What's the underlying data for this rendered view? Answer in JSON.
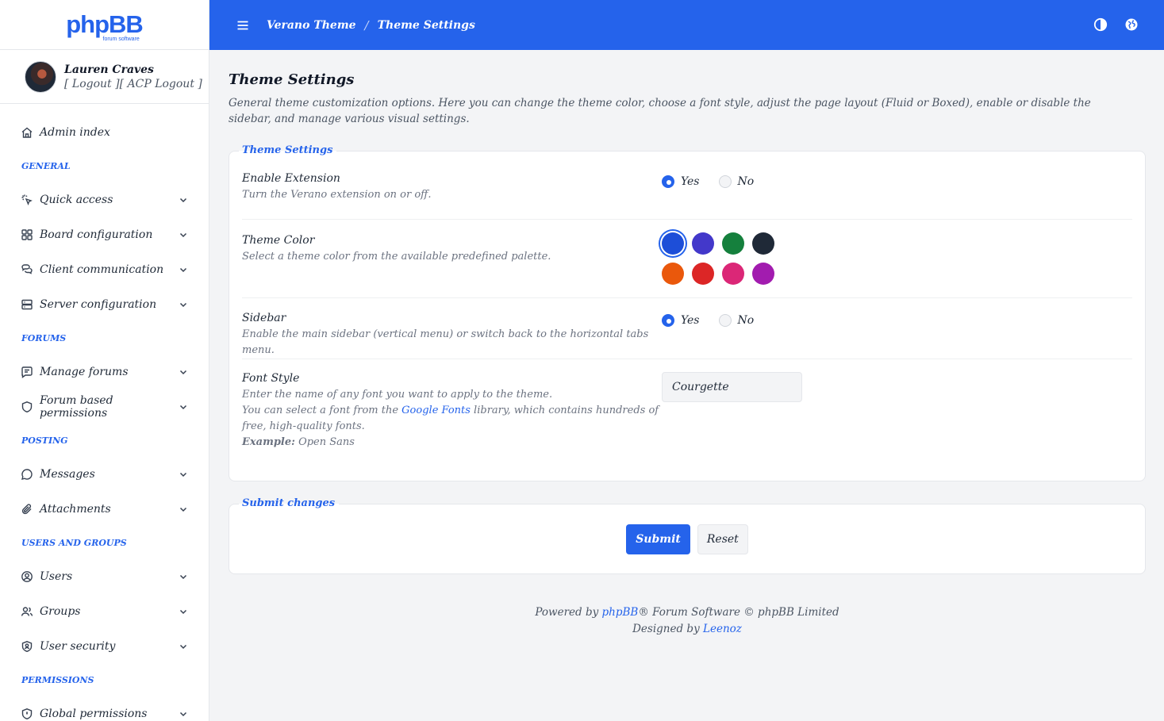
{
  "brand": {
    "logo": "phpBB",
    "logo_sub": "forum software"
  },
  "user": {
    "name": "Lauren Craves",
    "links": "[ Logout ][ ACP Logout ]"
  },
  "header": {
    "crumb_1": "Verano Theme",
    "crumb_sep": "/",
    "crumb_2": "Theme Settings"
  },
  "sidebar": {
    "admin_index": "Admin index",
    "sections": {
      "general": "General",
      "forums": "Forums",
      "posting": "Posting",
      "users_groups": "Users and Groups",
      "permissions": "Permissions"
    },
    "items": {
      "quick_access": "Quick access",
      "board_config": "Board configuration",
      "client_comm": "Client communication",
      "server_config": "Server configuration",
      "manage_forums": "Manage forums",
      "forum_perms": "Forum based permissions",
      "messages": "Messages",
      "attachments": "Attachments",
      "users": "Users",
      "groups": "Groups",
      "user_security": "User security",
      "global_perms": "Global permissions"
    }
  },
  "main": {
    "title": "Theme Settings",
    "description": "General theme customization options. Here you can change the theme color, choose a font style, adjust the page layout (Fluid or Boxed), enable or disable the sidebar, and manage various visual settings.",
    "settings_legend": "Theme Settings",
    "enable_ext": {
      "title": "Enable Extension",
      "desc": "Turn the Verano extension on or off.",
      "yes": "Yes",
      "no": "No",
      "selected": "yes"
    },
    "theme_color": {
      "title": "Theme Color",
      "desc": "Select a theme color from the available predefined palette.",
      "colors": [
        "#1d4ed8",
        "#4338ca",
        "#15803d",
        "#1f2937",
        "#ea580c",
        "#dc2626",
        "#db2777",
        "#a21caf"
      ],
      "selected": 0
    },
    "sidebar_opt": {
      "title": "Sidebar",
      "desc": "Enable the main sidebar (vertical menu) or switch back to the horizontal tabs menu.",
      "yes": "Yes",
      "no": "No",
      "selected": "yes"
    },
    "font_style": {
      "title": "Font Style",
      "desc_1": "Enter the name of any font you want to apply to the theme.",
      "desc_2a": "You can select a font from the ",
      "desc_link": "Google Fonts",
      "desc_2b": " library, which contains hundreds of free, high-quality fonts.",
      "example_label": "Example:",
      "example_value": " Open Sans",
      "value": "Courgette"
    },
    "submit_legend": "Submit changes",
    "submit_label": "Submit",
    "reset_label": "Reset"
  },
  "footer": {
    "powered_pre": "Powered by ",
    "powered_link": "phpBB",
    "powered_post": "® Forum Software © phpBB Limited",
    "designed_pre": "Designed by ",
    "designed_link": "Leenoz"
  },
  "colors": {
    "accent": "#2563eb",
    "background": "#f3f4f6"
  }
}
